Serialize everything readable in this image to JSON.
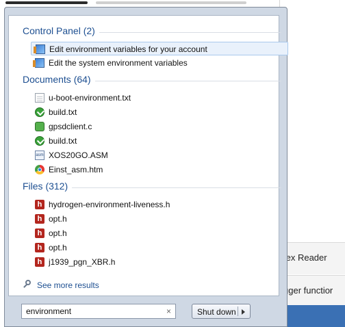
{
  "background_window": {
    "item1": "fex Reader",
    "item2": "gger functior"
  },
  "groups": {
    "control_panel": {
      "title": "Control Panel (2)",
      "items": [
        {
          "label": "Edit environment variables for your account",
          "icon": "control-panel-icon",
          "selected": true
        },
        {
          "label": "Edit the system environment variables",
          "icon": "control-panel-icon",
          "selected": false
        }
      ]
    },
    "documents": {
      "title": "Documents (64)",
      "items": [
        {
          "label": "u-boot-environment.txt",
          "icon": "text-file-icon"
        },
        {
          "label": "build.txt",
          "icon": "green-check-file-icon"
        },
        {
          "label": "gpsdclient.c",
          "icon": "c-source-file-icon"
        },
        {
          "label": "build.txt",
          "icon": "green-check-file-icon"
        },
        {
          "label": "XOS20GO.ASM",
          "icon": "asm-file-icon"
        },
        {
          "label": "Einst_asm.htm",
          "icon": "chrome-icon"
        }
      ]
    },
    "files": {
      "title": "Files (312)",
      "items": [
        {
          "label": "hydrogen-environment-liveness.h",
          "icon": "header-file-icon"
        },
        {
          "label": "opt.h",
          "icon": "header-file-icon"
        },
        {
          "label": "opt.h",
          "icon": "header-file-icon"
        },
        {
          "label": "opt.h",
          "icon": "header-file-icon"
        },
        {
          "label": "j1939_pgn_XBR.h",
          "icon": "header-file-icon"
        }
      ]
    }
  },
  "see_more": "See more results",
  "search": {
    "value": "environment",
    "clear": "×"
  },
  "shutdown": {
    "label": "Shut down"
  },
  "colors": {
    "accent": "#1d4f91",
    "selected_bg": "#e9f1fb",
    "frame": "#cfd8e4"
  }
}
